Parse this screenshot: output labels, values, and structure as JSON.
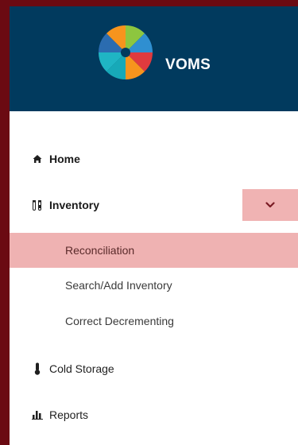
{
  "brand": {
    "name": "VOMS"
  },
  "menu": {
    "home": {
      "label": "Home",
      "icon": "home-icon"
    },
    "inventory": {
      "label": "Inventory",
      "icon": "vials-icon",
      "toggle_icon": "chevron-down-icon",
      "children": [
        {
          "label": "Reconciliation",
          "active": true
        },
        {
          "label": "Search/Add Inventory",
          "active": false
        },
        {
          "label": "Correct Decrementing",
          "active": false
        }
      ]
    },
    "cold_storage": {
      "label": "Cold Storage",
      "icon": "thermometer-icon"
    },
    "reports": {
      "label": "Reports",
      "icon": "bar-chart-icon"
    }
  },
  "colors": {
    "header_bg": "#013a5e",
    "frame": "#6b0a12",
    "active_bg": "#efb2b2"
  }
}
